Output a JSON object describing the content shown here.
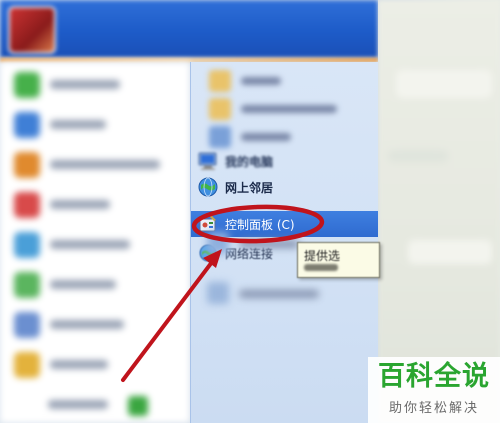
{
  "start_menu": {
    "right_items": {
      "my_computer": {
        "label": "我的电脑",
        "icon": "computer-icon"
      },
      "network_places": {
        "label": "网上邻居",
        "icon": "network-globe-icon"
      },
      "control_panel": {
        "label": "控制面板 (C)",
        "icon": "control-panel-icon",
        "highlighted": true
      },
      "network_connections": {
        "label": "网络连接",
        "icon": "network-connection-icon"
      }
    },
    "tooltip": {
      "text": "提供选"
    }
  },
  "annotation": {
    "highlight_color": "#c0141c",
    "target": "control_panel"
  },
  "watermark": {
    "title": "百科全说",
    "subtitle": "助你轻松解决",
    "color": "#2aa530"
  },
  "colors": {
    "header_blue": "#1d5bc8",
    "right_pane": "#d3e2f5",
    "highlight_bar": "#2f6bd0"
  }
}
